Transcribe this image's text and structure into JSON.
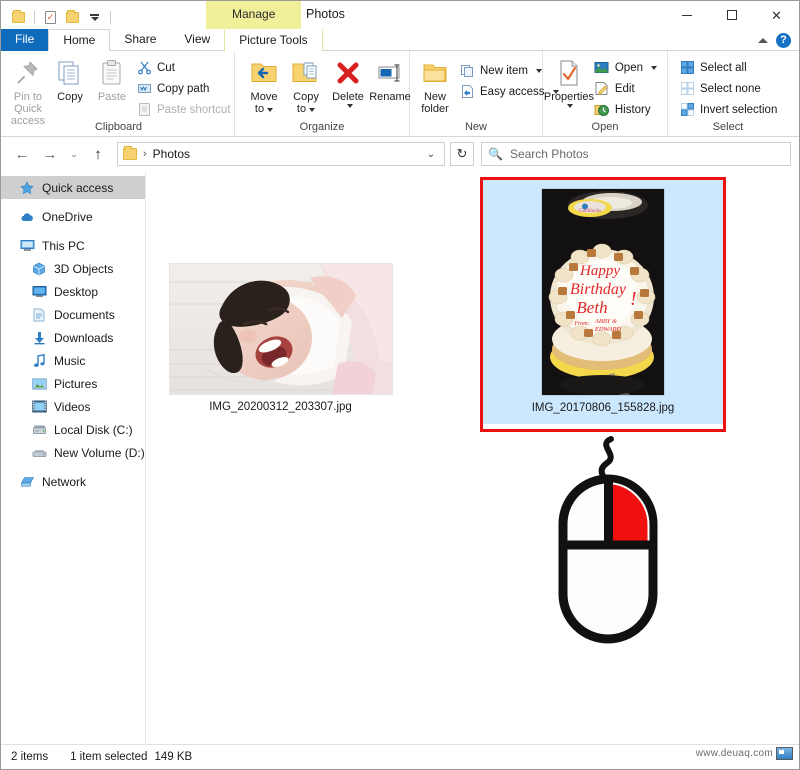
{
  "window": {
    "title": "Photos",
    "contextual_tab_title": "Manage",
    "quick_access_items": [
      "folder-icon",
      "properties-icon",
      "new-folder-icon",
      "customize-chevron-icon"
    ],
    "controls": {
      "minimize": "minimize-icon",
      "maximize": "maximize-icon",
      "close": "close-icon"
    }
  },
  "tabs": [
    {
      "label": "File",
      "type": "file"
    },
    {
      "label": "Home",
      "type": "active"
    },
    {
      "label": "Share",
      "type": "normal"
    },
    {
      "label": "View",
      "type": "normal"
    },
    {
      "label": "Picture Tools",
      "type": "contextual"
    }
  ],
  "tab_right": {
    "collapse_ribbon": "chevron-up-icon",
    "help": "?"
  },
  "ribbon": {
    "groups": [
      {
        "label": "Clipboard",
        "big_buttons": [
          {
            "label_line1": "Pin to Quick",
            "label_line2": "access",
            "icon": "pin-icon",
            "dim": true
          },
          {
            "label_line1": "Copy",
            "label_line2": "",
            "icon": "copy-icon",
            "dim": false
          },
          {
            "label_line1": "Paste",
            "label_line2": "",
            "icon": "paste-icon",
            "dim": true
          }
        ],
        "small_buttons": [
          {
            "label": "Cut",
            "icon": "scissors-icon",
            "dim": false,
            "caret": false
          },
          {
            "label": "Copy path",
            "icon": "copy-path-icon",
            "dim": false,
            "caret": false
          },
          {
            "label": "Paste shortcut",
            "icon": "paste-shortcut-icon",
            "dim": true,
            "caret": false
          }
        ]
      },
      {
        "label": "Organize",
        "big_buttons": [
          {
            "label_line1": "Move",
            "label_line2": "to",
            "icon": "move-to-icon",
            "dim": false,
            "caret": true
          },
          {
            "label_line1": "Copy",
            "label_line2": "to",
            "icon": "copy-to-icon",
            "dim": false,
            "caret": true
          },
          {
            "label_line1": "Delete",
            "label_line2": "",
            "icon": "delete-icon",
            "dim": false,
            "caret_under": true
          },
          {
            "label_line1": "Rename",
            "label_line2": "",
            "icon": "rename-icon",
            "dim": false
          }
        ],
        "small_buttons": []
      },
      {
        "label": "New",
        "big_buttons": [
          {
            "label_line1": "New",
            "label_line2": "folder",
            "icon": "new-folder-icon",
            "dim": false
          }
        ],
        "small_buttons": [
          {
            "label": "New item",
            "icon": "new-item-icon",
            "dim": false,
            "caret": true
          },
          {
            "label": "Easy access",
            "icon": "easy-access-icon",
            "dim": false,
            "caret": true
          }
        ]
      },
      {
        "label": "Open",
        "big_buttons": [
          {
            "label_line1": "Properties",
            "label_line2": "",
            "icon": "properties-icon",
            "dim": false,
            "caret_under": true
          }
        ],
        "small_buttons": [
          {
            "label": "Open",
            "icon": "open-picture-icon",
            "dim": false,
            "caret": true
          },
          {
            "label": "Edit",
            "icon": "edit-icon",
            "dim": false,
            "caret": false
          },
          {
            "label": "History",
            "icon": "history-icon",
            "dim": false,
            "caret": false
          }
        ]
      },
      {
        "label": "Select",
        "big_buttons": [],
        "small_buttons": [
          {
            "label": "Select all",
            "icon": "select-all-icon",
            "dim": false,
            "caret": false
          },
          {
            "label": "Select none",
            "icon": "select-none-icon",
            "dim": false,
            "caret": false
          },
          {
            "label": "Invert selection",
            "icon": "invert-selection-icon",
            "dim": false,
            "caret": false
          }
        ]
      }
    ]
  },
  "navbar": {
    "back": "back-arrow-icon",
    "forward": "forward-arrow-icon",
    "recent": "recent-locations-icon",
    "up": "up-arrow-icon",
    "breadcrumb": [
      "Photos"
    ],
    "dropdown": "chevron-down-icon",
    "refresh": "refresh-icon"
  },
  "search": {
    "placeholder": "Search Photos",
    "icon": "search-icon"
  },
  "sidebar": {
    "items": [
      {
        "label": "Quick access",
        "icon": "star-icon",
        "indent": false,
        "selected": true,
        "gap_after": true
      },
      {
        "label": "OneDrive",
        "icon": "cloud-icon",
        "indent": false,
        "selected": false,
        "gap_after": true
      },
      {
        "label": "This PC",
        "icon": "monitor-icon",
        "indent": false,
        "selected": false,
        "gap_after": false
      },
      {
        "label": "3D Objects",
        "icon": "3d-objects-icon",
        "indent": true,
        "selected": false,
        "gap_after": false
      },
      {
        "label": "Desktop",
        "icon": "desktop-icon",
        "indent": true,
        "selected": false,
        "gap_after": false
      },
      {
        "label": "Documents",
        "icon": "documents-icon",
        "indent": true,
        "selected": false,
        "gap_after": false
      },
      {
        "label": "Downloads",
        "icon": "downloads-icon",
        "indent": true,
        "selected": false,
        "gap_after": false
      },
      {
        "label": "Music",
        "icon": "music-icon",
        "indent": true,
        "selected": false,
        "gap_after": false
      },
      {
        "label": "Pictures",
        "icon": "pictures-icon",
        "indent": true,
        "selected": false,
        "gap_after": false
      },
      {
        "label": "Videos",
        "icon": "videos-icon",
        "indent": true,
        "selected": false,
        "gap_after": false
      },
      {
        "label": "Local Disk (C:)",
        "icon": "local-disk-icon",
        "indent": true,
        "selected": false,
        "gap_after": false
      },
      {
        "label": "New Volume (D:)",
        "icon": "drive-icon",
        "indent": true,
        "selected": false,
        "gap_after": true
      },
      {
        "label": "Network",
        "icon": "network-icon",
        "indent": false,
        "selected": false,
        "gap_after": false
      }
    ]
  },
  "files": [
    {
      "name": "IMG_20200312_203307.jpg",
      "selected": false,
      "kind": "baby-photo"
    },
    {
      "name": "IMG_20170806_155828.jpg",
      "selected": true,
      "kind": "birthday-cake-photo"
    }
  ],
  "cake_text": {
    "line1": "Happy",
    "line2": "Birthday",
    "line3": "Beth",
    "line4": "From:",
    "line5": "ABBY &",
    "line6": "EDWARD"
  },
  "overlay": {
    "name": "right-click-mouse-illustration",
    "highlighted_button": "right",
    "highlight_color": "#ee1111"
  },
  "statusbar": {
    "item_count": "2 items",
    "selection": "1 item selected",
    "size": "149 KB"
  },
  "watermark": {
    "text": "www.deuaq.com"
  },
  "colors": {
    "selection_fill": "#cce8ff",
    "annotation_red": "#ee1111",
    "file_tab_blue": "#0f6cbd",
    "contextual_yellow": "#f0ef9a"
  }
}
